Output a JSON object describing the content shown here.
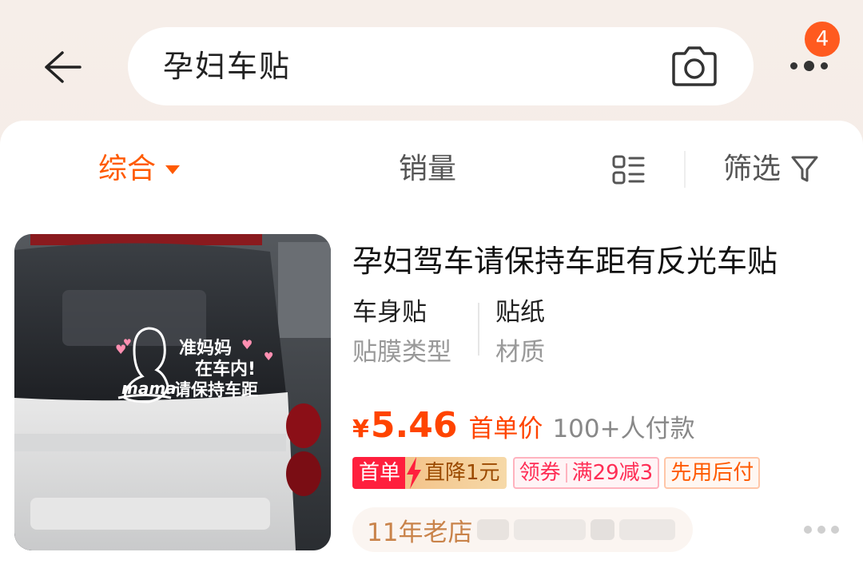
{
  "header": {
    "search_query": "孕妇车贴",
    "message_badge_count": "4"
  },
  "sort_bar": {
    "comprehensive_label": "综合",
    "sales_label": "销量",
    "filter_label": "筛选"
  },
  "product": {
    "title": "孕妇驾车请保持车距有反光车贴",
    "attributes": [
      {
        "value": "车身贴",
        "key": "贴膜类型"
      },
      {
        "value": "贴纸",
        "key": "材质"
      }
    ],
    "image_sticker_text": [
      "准妈妈",
      "在车内!",
      "请保持车距",
      "mama"
    ],
    "currency": "¥",
    "price": "5.46",
    "price_label": "首单价",
    "sold_count": "100+人付款",
    "tags": {
      "first_order": "首单",
      "discount": "直降1元",
      "coupon": "领券",
      "coupon_rule": "满29减3",
      "pay_later": "先用后付"
    },
    "shop_age": "11年老店"
  },
  "colors": {
    "accent": "#ff5a00",
    "price": "#ff4400",
    "badge": "#ff5a1f"
  }
}
